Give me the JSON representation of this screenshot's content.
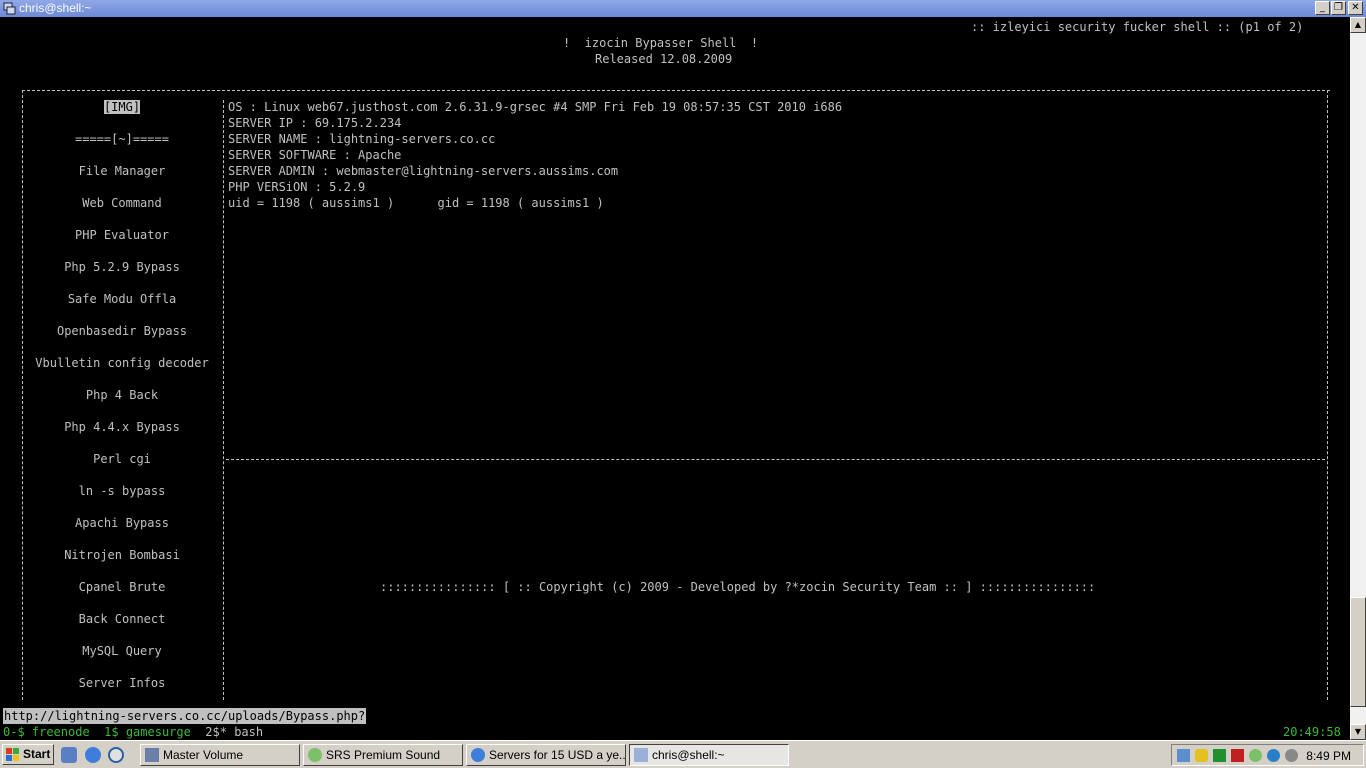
{
  "window": {
    "title": "chris@shell:~"
  },
  "header": {
    "right": ":: izleyici security fucker shell :: (p1 of 2)",
    "title": "!  izocin Bypasser Shell  !",
    "released": "Released 12.08.2009"
  },
  "menu": {
    "items": [
      "[IMG]",
      "=====[~]=====",
      "File Manager",
      "Web Command",
      "PHP Evaluator",
      "Php 5.2.9 Bypass",
      "Safe Modu Offla",
      "Openbasedir Bypass",
      "Vbulletin config decoder",
      "Php 4 Back",
      "Php 4.4.x Bypass",
      "Perl cgi",
      "ln -s bypass",
      "Apachi Bypass",
      "Nitrojen Bombasi",
      "Cpanel Brute",
      "Back Connect",
      "MySQL Query",
      "Server Infos"
    ]
  },
  "info": {
    "os": "OS : Linux web67.justhost.com 2.6.31.9-grsec #4 SMP Fri Feb 19 08:57:35 CST 2010 i686",
    "ip": "SERVER IP : 69.175.2.234",
    "name": "SERVER NAME : lightning-servers.co.cc",
    "software": "SERVER SOFTWARE : Apache",
    "admin": "SERVER ADMIN : webmaster@lightning-servers.aussims.com",
    "php": "PHP VERSiON : 5.2.9",
    "uid": "uid = 1198 ( aussims1 )      gid = 1198 ( aussims1 )"
  },
  "footer": {
    "copyright": ":::::::::::::::: [ :: Copyright (c) 2009 - Developed by ?*zocin Security Team :: ] ::::::::::::::::"
  },
  "status": {
    "url": "http://lightning-servers.co.cc/uploads/Bypass.php?",
    "windows": "0-$ freenode  1$ gamesurge  ",
    "current": "2$* bash",
    "time": "20:49:58"
  },
  "taskbar": {
    "start": "Start",
    "tasks": [
      "Master Volume",
      "SRS Premium Sound",
      "Servers for 15 USD a ye...",
      "chris@shell:~"
    ],
    "clock": "8:49 PM"
  },
  "colors": {
    "titlebar": "#6d89d6",
    "terminal_bg": "#000000",
    "terminal_fg": "#c0c0c0",
    "screen_green": "#3cb83c",
    "taskbar": "#d4d0c8"
  }
}
